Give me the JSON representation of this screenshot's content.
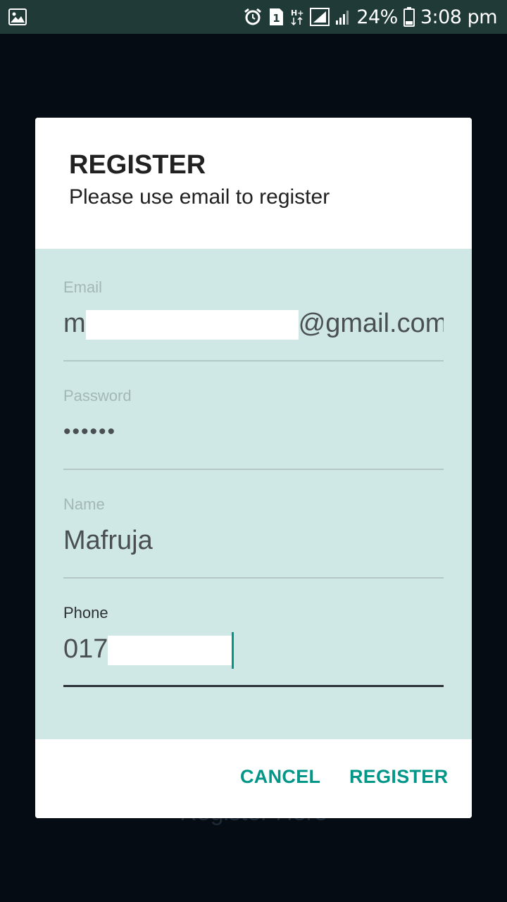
{
  "status_bar": {
    "battery": "24%",
    "time": "3:08 pm",
    "sim_badge": "1",
    "network_type": "H+",
    "icons": [
      "gallery-icon",
      "alarm-icon",
      "sim-icon",
      "network-type-icon",
      "signal-icon",
      "signal-2-icon",
      "battery-icon"
    ]
  },
  "background": {
    "link_text": "Register Here"
  },
  "dialog": {
    "title": "REGISTER",
    "subtitle": "Please use email to register",
    "fields": {
      "email": {
        "label": "Email",
        "value_prefix": "m",
        "value_suffix": "@gmail.com"
      },
      "password": {
        "label": "Password",
        "value": "••••••"
      },
      "name": {
        "label": "Name",
        "value": "Mafruja"
      },
      "phone": {
        "label": "Phone",
        "value_prefix": "017"
      }
    },
    "actions": {
      "cancel": "CANCEL",
      "register": "REGISTER"
    }
  },
  "colors": {
    "accent": "#009688",
    "dialog_body": "#cfe7e5",
    "status_bar": "#1f3a37",
    "backdrop": "#050c14"
  }
}
